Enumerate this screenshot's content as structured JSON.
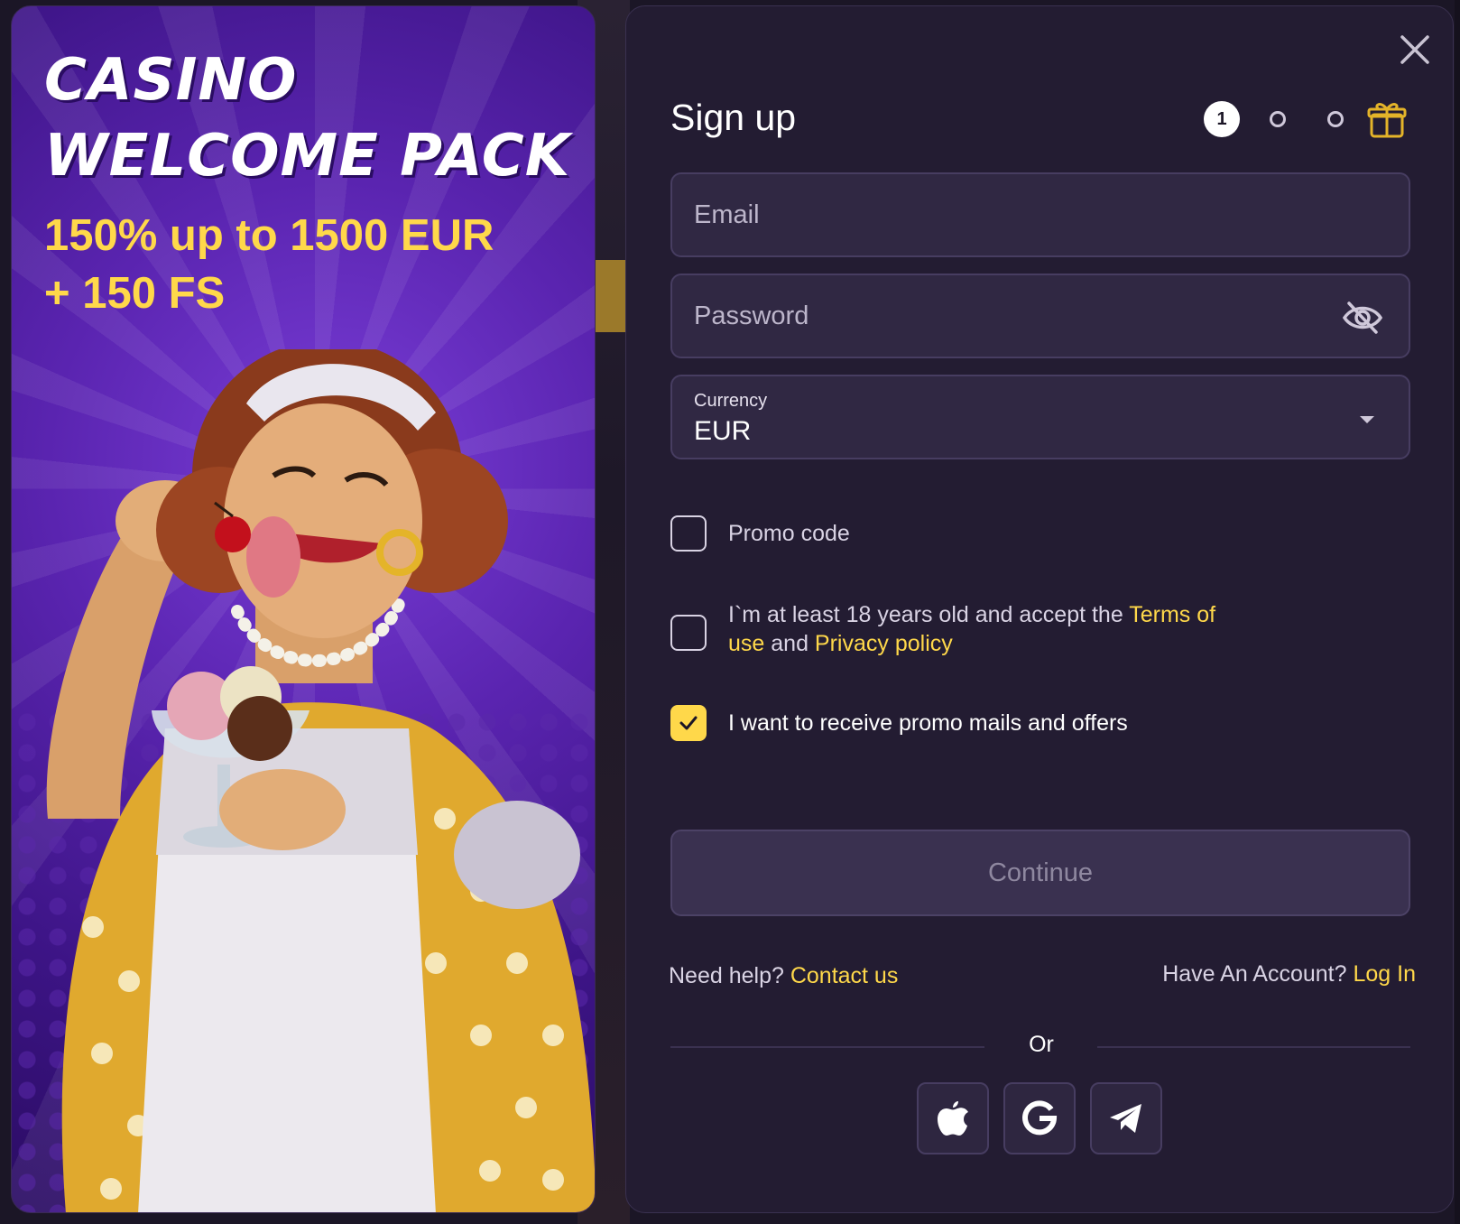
{
  "banner": {
    "title_line1": "CASINO",
    "title_line2": "WELCOME PACK",
    "offer_line1": "150% up to 1500 EUR",
    "offer_line2": "+ 150 FS"
  },
  "modal": {
    "heading": "Sign up",
    "steps": {
      "current": "1"
    },
    "email": {
      "placeholder": "Email"
    },
    "password": {
      "placeholder": "Password"
    },
    "currency": {
      "label": "Currency",
      "value": "EUR"
    },
    "promo_code": {
      "label": "Promo code",
      "checked": false
    },
    "terms": {
      "prefix": "I`m at least 18 years old and accept the ",
      "terms_link": "Terms of use",
      "and": " and ",
      "privacy_link": "Privacy policy",
      "checked": false
    },
    "promo_mails": {
      "label": "I want to receive promo mails and offers",
      "checked": true
    },
    "continue_label": "Continue",
    "help": {
      "text": "Need help? ",
      "link": "Contact us"
    },
    "account": {
      "text": "Have An Account? ",
      "link": "Log In"
    },
    "or_label": "Or",
    "social": [
      "apple-icon",
      "google-icon",
      "telegram-icon"
    ]
  },
  "colors": {
    "accent": "#ffd84a",
    "modal_bg": "#231c32",
    "field_bg": "#302843",
    "banner_purple": "#5a24b0"
  }
}
